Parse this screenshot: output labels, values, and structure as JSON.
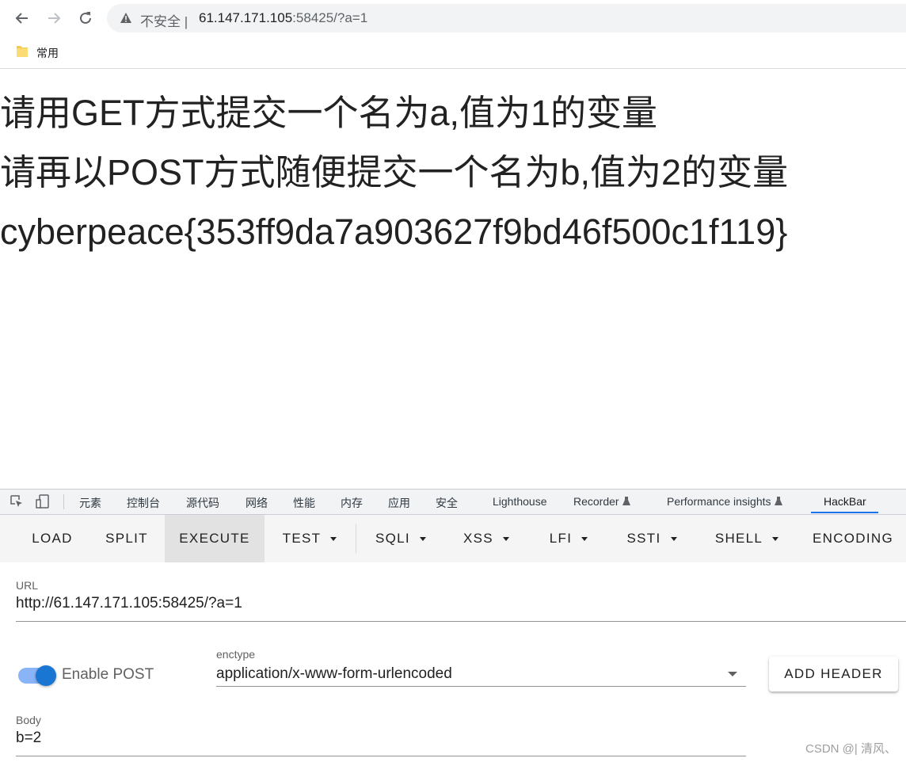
{
  "browser": {
    "insecure_label": "不安全",
    "address_host": "61.147.171.105",
    "address_rest": ":58425/?a=1",
    "bookmark_folder": "常用"
  },
  "page": {
    "lines": [
      "请用GET方式提交一个名为a,值为1的变量",
      "请再以POST方式随便提交一个名为b,值为2的变量",
      "cyberpeace{353ff9da7a903627f9bd46f500c1f119}"
    ]
  },
  "devtools": {
    "tabs": [
      "元素",
      "控制台",
      "源代码",
      "网络",
      "性能",
      "内存",
      "应用",
      "安全",
      "Lighthouse",
      "Recorder",
      "Performance insights",
      "HackBar"
    ],
    "active_tab": "HackBar"
  },
  "hackbar": {
    "buttons": [
      "LOAD",
      "SPLIT",
      "EXECUTE",
      "TEST",
      "SQLI",
      "XSS",
      "LFI",
      "SSTI",
      "SHELL",
      "ENCODING"
    ],
    "active_button": "EXECUTE",
    "url_label": "URL",
    "url_value": "http://61.147.171.105:58425/?a=1",
    "enable_post_label": "Enable POST",
    "enable_post": true,
    "enctype_label": "enctype",
    "enctype_value": "application/x-www-form-urlencoded",
    "add_header_label": "ADD HEADER",
    "body_label": "Body",
    "body_value": "b=2"
  },
  "watermark": "CSDN @| 清风、",
  "colors": {
    "accent": "#1976d2",
    "tab_underline": "#1a73e8"
  }
}
